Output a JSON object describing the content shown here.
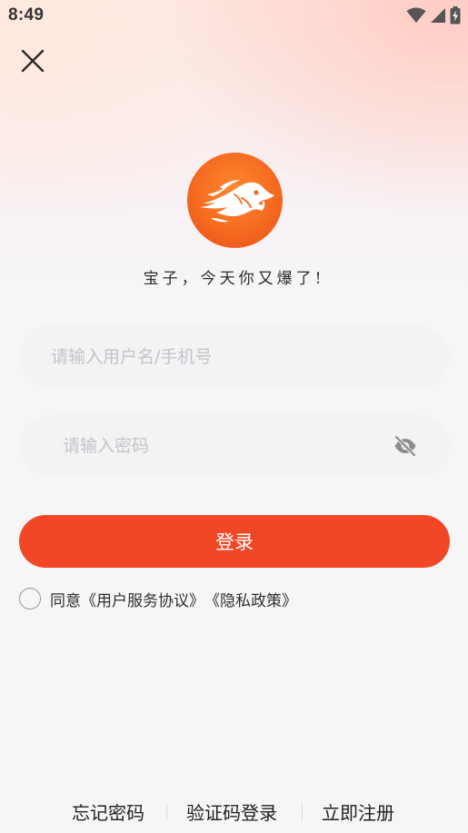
{
  "status_bar": {
    "time": "8:49",
    "icons": [
      "wifi-icon",
      "signal-icon",
      "battery-charging-icon"
    ]
  },
  "header": {
    "close_icon": "close-icon"
  },
  "brand": {
    "logo_icon": "flame-wolf-logo",
    "slogan": "宝子，今天你又爆了!"
  },
  "form": {
    "username": {
      "value": "",
      "placeholder": "请输入用户名/手机号"
    },
    "password": {
      "value": "",
      "placeholder": "请输入密码",
      "toggle_icon": "eye-off-icon"
    },
    "login_label": "登录"
  },
  "agreement": {
    "checked": false,
    "prefix": "同意",
    "user_agreement": "《用户服务协议》",
    "privacy_policy": "《隐私政策》"
  },
  "footer": {
    "forgot_password": "忘记密码",
    "sms_login": "验证码登录",
    "register": "立即注册"
  },
  "colors": {
    "primary": "#f24727",
    "logo_orange": "#f46a1f",
    "placeholder": "#c4c4c8",
    "text": "#2e2e2e"
  }
}
